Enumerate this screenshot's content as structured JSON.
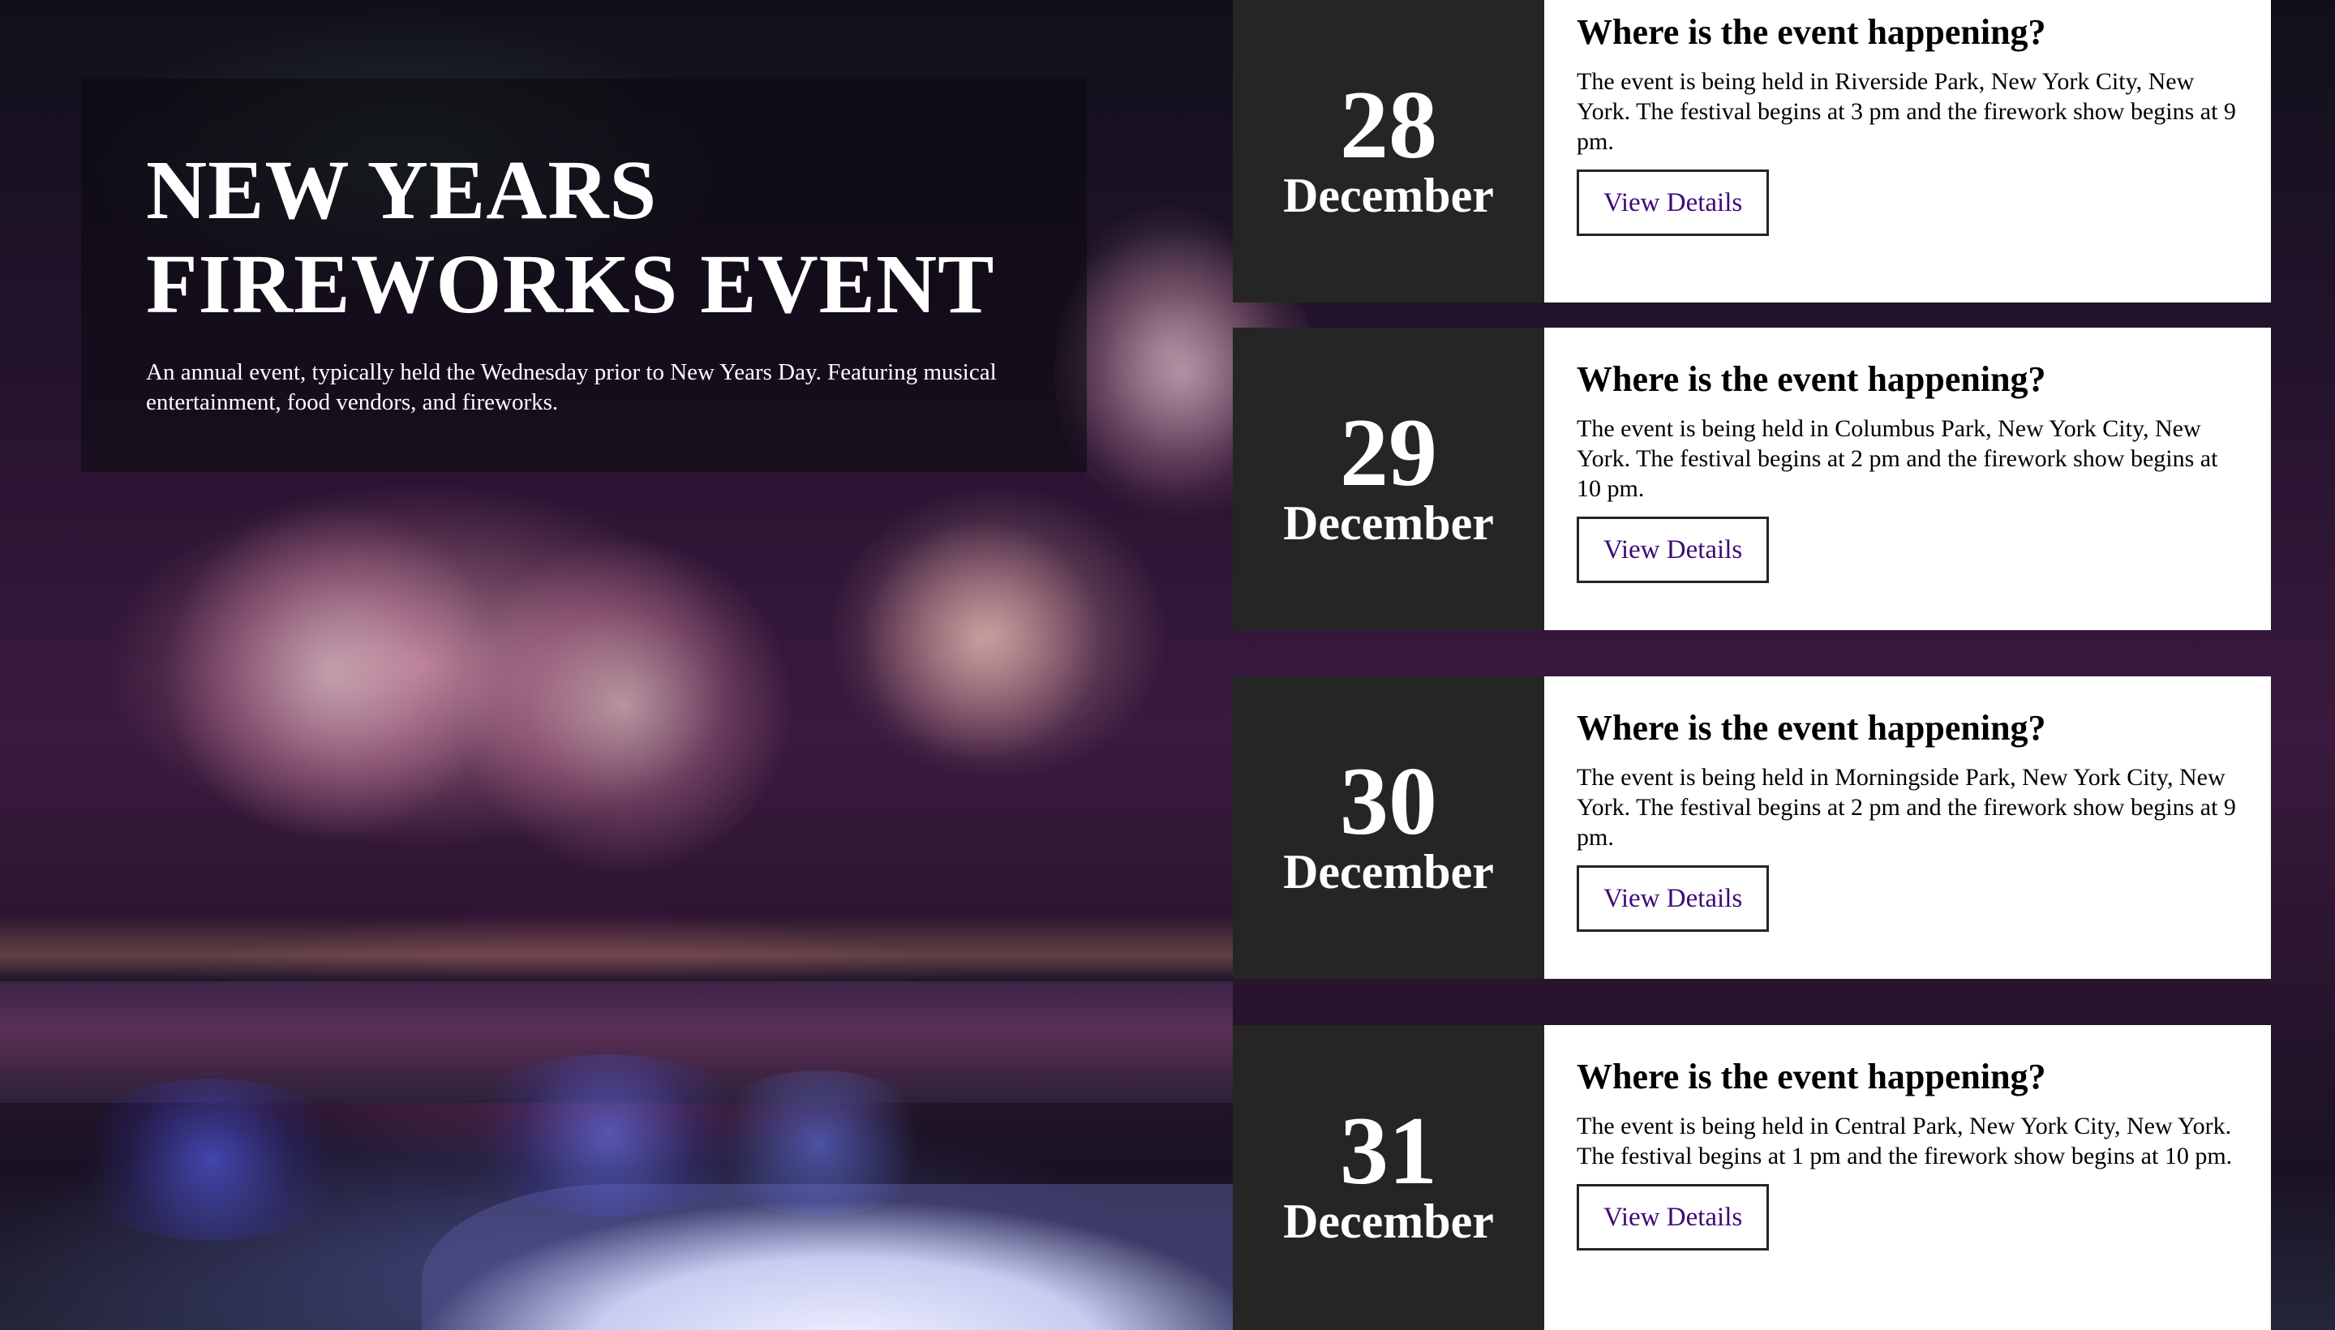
{
  "hero": {
    "title_line1": "NEW YEARS",
    "title_line2": "FIREWORKS EVENT",
    "description": "An annual event, typically held the Wednesday prior to New Years Day. Featuring musical entertainment, food vendors, and fireworks."
  },
  "events": [
    {
      "day": "28",
      "month": "December",
      "heading": "Where is the event happening?",
      "text": "The event is being held in Riverside Park, New York City, New York. The festival begins at 3 pm and the firework show begins at 9 pm.",
      "button": "View Details"
    },
    {
      "day": "29",
      "month": "December",
      "heading": "Where is the event happening?",
      "text": "The event is being held in Columbus Park, New York City, New York. The festival begins at 2 pm and the firework show begins at 10 pm.",
      "button": "View Details"
    },
    {
      "day": "30",
      "month": "December",
      "heading": "Where is the event happening?",
      "text": "The event is being held in Morningside Park, New York City, New York. The festival begins at 2 pm and the firework show begins at 9 pm.",
      "button": "View Details"
    },
    {
      "day": "31",
      "month": "December",
      "heading": "Where is the event happening?",
      "text": "The event is being held in Central Park, New York City, New York. The festival begins at 1 pm and the firework show begins at 10 pm.",
      "button": "View Details"
    }
  ],
  "colors": {
    "date_block_bg": "#252525",
    "info_bg": "#ffffff",
    "button_text": "#3d0a78",
    "hero_text": "#ffffff"
  }
}
